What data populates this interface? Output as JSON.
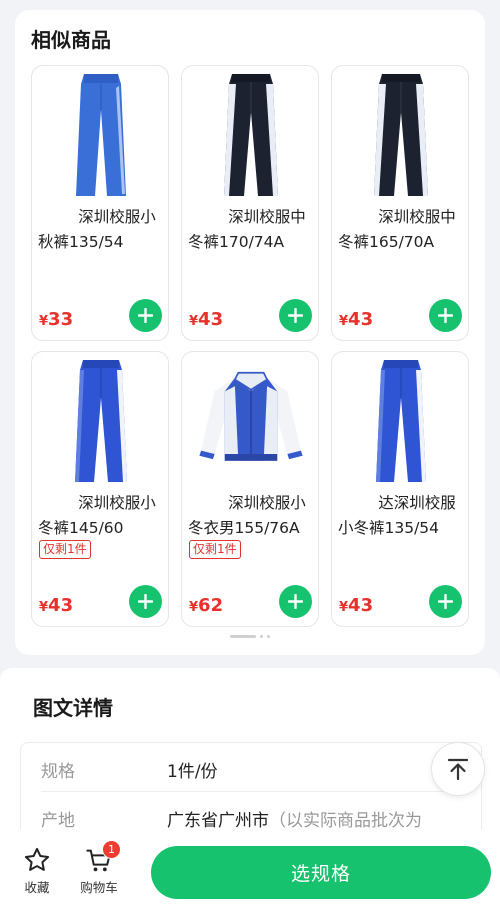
{
  "similar": {
    "title": "相似商品",
    "products": [
      {
        "name": "深圳校服小秋裤135/54",
        "currency": "¥",
        "price": "33",
        "stock": "",
        "image": "blue-pants-side-stripe-icon"
      },
      {
        "name": "深圳校服中冬裤170/74A",
        "currency": "¥",
        "price": "43",
        "stock": "",
        "image": "navy-pants-white-stripe-icon"
      },
      {
        "name": "深圳校服中冬裤165/70A",
        "currency": "¥",
        "price": "43",
        "stock": "",
        "image": "navy-pants-white-stripe-icon"
      },
      {
        "name": "深圳校服小冬裤145/60",
        "currency": "¥",
        "price": "43",
        "stock": "仅剩1件",
        "image": "blue-pants-white-stripe-icon"
      },
      {
        "name": "深圳校服小冬衣男155/76A",
        "currency": "¥",
        "price": "62",
        "stock": "仅剩1件",
        "image": "blue-white-jacket-icon"
      },
      {
        "name": "达深圳校服小冬裤135/54",
        "currency": "¥",
        "price": "43",
        "stock": "",
        "image": "blue-pants-white-stripe-icon"
      }
    ]
  },
  "details": {
    "title": "图文详情",
    "rows": [
      {
        "key": "规格",
        "value": "1件/份",
        "note": ""
      },
      {
        "key": "产地",
        "value": "广东省广州市",
        "note": "（以实际商品批次为"
      }
    ]
  },
  "bottom_bar": {
    "favorite_label": "收藏",
    "cart_label": "购物车",
    "cart_count": "1",
    "select_spec_label": "选规格"
  },
  "colors": {
    "accent_green": "#16c26d",
    "price_red": "#e7322c",
    "badge_red": "#f03b30"
  }
}
